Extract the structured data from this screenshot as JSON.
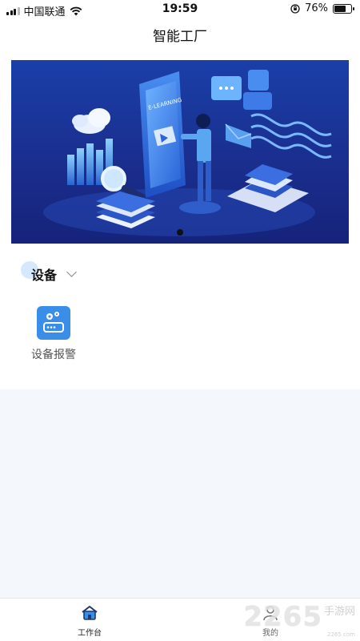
{
  "status_bar": {
    "carrier": "中国联通",
    "time": "19:59",
    "battery_percent": "76%",
    "battery_level": 0.76
  },
  "nav": {
    "title": "智能工厂"
  },
  "banner": {
    "screen_text": "E-LEARNING",
    "page_count": 1,
    "active_index": 0
  },
  "device_section": {
    "title": "设备",
    "tiles": [
      {
        "label": "设备报警",
        "icon": "router-gear-icon"
      }
    ]
  },
  "tab_bar": {
    "tabs": [
      {
        "label": "工作台",
        "icon": "home-icon",
        "active": true
      },
      {
        "label": "我的",
        "icon": "user-icon",
        "active": false
      }
    ]
  },
  "watermark": {
    "number": "2265",
    "text": "手游网",
    "url": "2265.com"
  },
  "colors": {
    "accent": "#3a8ee8",
    "banner_bg": "#1a3fa8",
    "page_bg": "#f4f7fb"
  }
}
